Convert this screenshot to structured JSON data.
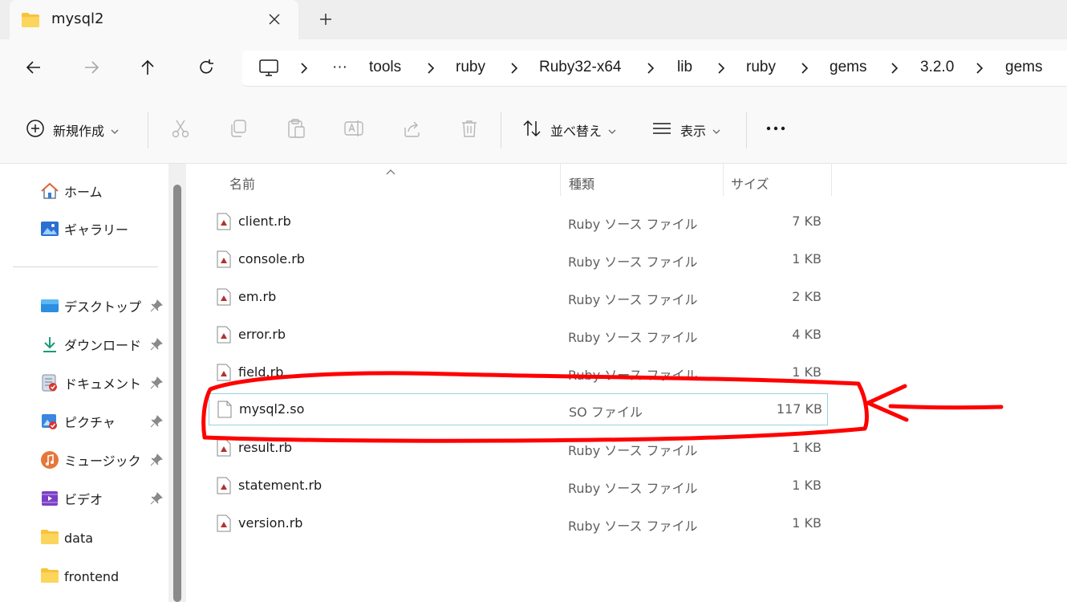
{
  "window": {
    "tab_title": "mysql2"
  },
  "address": {
    "overflow": "···",
    "path": [
      "tools",
      "ruby",
      "Ruby32-x64",
      "lib",
      "ruby",
      "gems",
      "3.2.0",
      "gems"
    ]
  },
  "commands": {
    "new_label": "新規作成",
    "sort_label": "並べ替え",
    "view_label": "表示",
    "more_label": "···"
  },
  "sidebar": {
    "top_items": [
      {
        "label": "ホーム",
        "icon": "home-icon"
      },
      {
        "label": "ギャラリー",
        "icon": "gallery-icon"
      }
    ],
    "pinned_items": [
      {
        "label": "デスクトップ",
        "icon": "desktop-icon"
      },
      {
        "label": "ダウンロード",
        "icon": "download-icon"
      },
      {
        "label": "ドキュメント",
        "icon": "documents-icon"
      },
      {
        "label": "ピクチャ",
        "icon": "pictures-icon"
      },
      {
        "label": "ミュージック",
        "icon": "music-icon"
      },
      {
        "label": "ビデオ",
        "icon": "video-icon"
      }
    ],
    "folders": [
      {
        "label": "data",
        "icon": "folder-icon"
      },
      {
        "label": "frontend",
        "icon": "folder-icon"
      }
    ]
  },
  "file_list": {
    "columns": {
      "name": "名前",
      "type": "種類",
      "size": "サイズ"
    },
    "files": [
      {
        "name": "client.rb",
        "type": "Ruby ソース ファイル",
        "size": "7 KB",
        "icon": "ruby-file-icon"
      },
      {
        "name": "console.rb",
        "type": "Ruby ソース ファイル",
        "size": "1 KB",
        "icon": "ruby-file-icon"
      },
      {
        "name": "em.rb",
        "type": "Ruby ソース ファイル",
        "size": "2 KB",
        "icon": "ruby-file-icon"
      },
      {
        "name": "error.rb",
        "type": "Ruby ソース ファイル",
        "size": "4 KB",
        "icon": "ruby-file-icon"
      },
      {
        "name": "field.rb",
        "type": "Ruby ソース ファイル",
        "size": "1 KB",
        "icon": "ruby-file-icon"
      },
      {
        "name": "mysql2.so",
        "type": "SO ファイル",
        "size": "117 KB",
        "icon": "generic-file-icon",
        "selected": true
      },
      {
        "name": "result.rb",
        "type": "Ruby ソース ファイル",
        "size": "1 KB",
        "icon": "ruby-file-icon"
      },
      {
        "name": "statement.rb",
        "type": "Ruby ソース ファイル",
        "size": "1 KB",
        "icon": "ruby-file-icon"
      },
      {
        "name": "version.rb",
        "type": "Ruby ソース ファイル",
        "size": "1 KB",
        "icon": "ruby-file-icon"
      }
    ]
  },
  "colors": {
    "annotation": "#ff0000",
    "ruby_icon": "#b0332f",
    "selection_border": "#99d1e3"
  }
}
